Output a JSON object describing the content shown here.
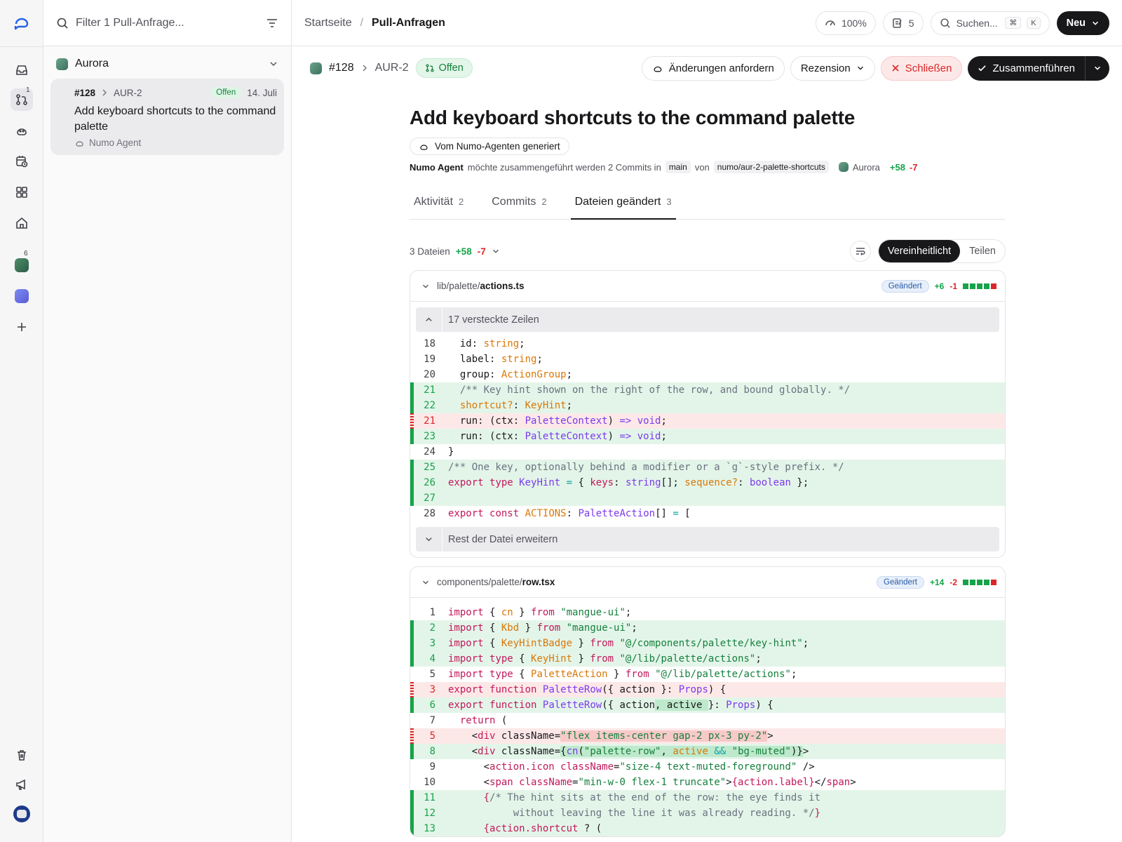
{
  "rail": {
    "pulls_badge": "1",
    "repo_badge": "6"
  },
  "list": {
    "filter_placeholder": "Filter 1 Pull-Anfrage...",
    "repo_name": "Aurora",
    "card": {
      "number": "#128",
      "key": "AUR-2",
      "status": "Offen",
      "date": "14. Juli",
      "title": "Add keyboard shortcuts to the command palette",
      "author": "Numo Agent"
    }
  },
  "topbar": {
    "crumb_home": "Startseite",
    "crumb_current": "Pull-Anfragen",
    "zoom": "100%",
    "notes_count": "5",
    "search_placeholder": "Suchen...",
    "kbd_mod": "⌘",
    "kbd_key": "K",
    "new_label": "Neu"
  },
  "pr": {
    "number": "#128",
    "key": "AUR-2",
    "status": "Offen",
    "request_changes": "Änderungen anfordern",
    "review": "Rezension",
    "close": "Schließen",
    "merge": "Zusammenführen",
    "title": "Add keyboard shortcuts to the command palette",
    "generated": "Vom Numo-Agenten generiert",
    "meta": {
      "author": "Numo Agent",
      "text1": "möchte zusammengeführt werden 2 Commits in",
      "base": "main",
      "text2": "von",
      "head": "numo/aur-2-palette-shortcuts",
      "repo": "Aurora",
      "added": "+58",
      "removed": "-7"
    }
  },
  "tabs": [
    {
      "label": "Aktivität",
      "count": "2"
    },
    {
      "label": "Commits",
      "count": "2"
    },
    {
      "label": "Dateien geändert",
      "count": "3"
    }
  ],
  "filebar": {
    "summary": "3 Dateien",
    "added": "+58",
    "removed": "-7",
    "unified": "Vereinheitlicht",
    "split": "Teilen"
  },
  "files": [
    {
      "dir": "lib/palette/",
      "name": "actions.ts",
      "badge": "Geändert",
      "added": "+6",
      "removed": "-1",
      "hidden": "17 versteckte Zeilen",
      "expand": "Rest der Datei erweitern"
    },
    {
      "dir": "components/palette/",
      "name": "row.tsx",
      "badge": "Geändert",
      "added": "+14",
      "removed": "-2"
    }
  ],
  "colors": {
    "add": "#16a34a",
    "del": "#dc2626",
    "accent": "#18181b"
  }
}
